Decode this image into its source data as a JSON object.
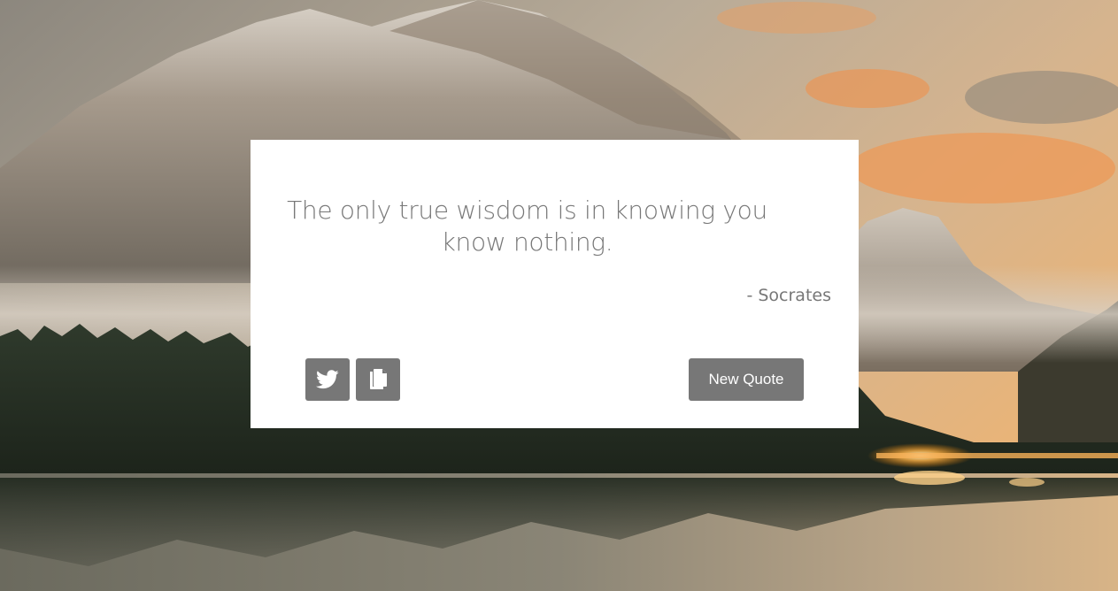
{
  "quote": {
    "text": "The only true wisdom is in knowing you know nothing.",
    "author": "- Socrates"
  },
  "actions": {
    "new_quote_label": "New Quote",
    "tweet_icon": "twitter-icon",
    "copy_icon": "copy-icon"
  },
  "colors": {
    "card_background": "#ffffff",
    "button": "#777777",
    "text": "#777777",
    "button_text": "#ffffff"
  },
  "background": {
    "scene": "mountain-lake-sunset-photo"
  }
}
